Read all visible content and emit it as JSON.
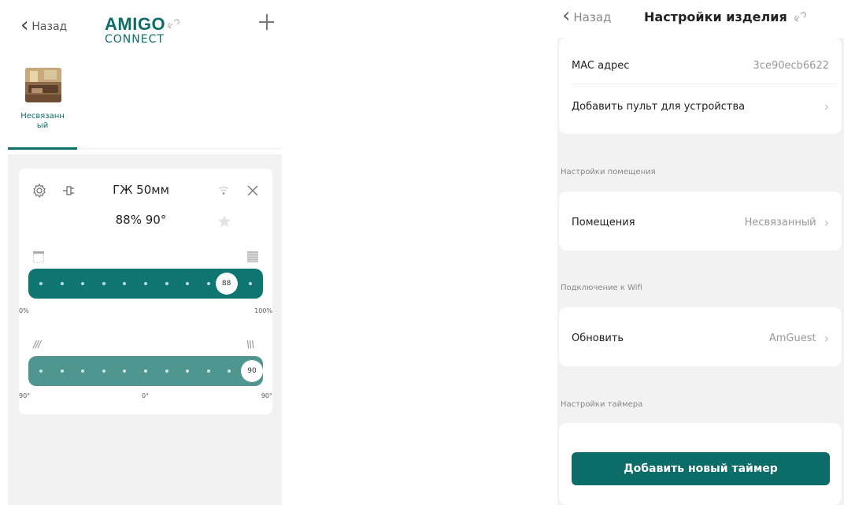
{
  "left_screen": {
    "back_label": "Назад",
    "logo": {
      "top": "AMIGO",
      "bottom": "CONNECT"
    },
    "icons": {
      "back": "chevron-left-icon",
      "add": "plus-icon"
    },
    "rooms": [
      {
        "label": "Несвязанный",
        "label_lines": [
          "Несвязанн",
          "ый"
        ],
        "selected": true
      }
    ],
    "device": {
      "name": "ГЖ 50мм",
      "status": "88% 90°",
      "icons": [
        "gear-icon",
        "plug-icon",
        "wifi-icon",
        "close-icon",
        "star-icon"
      ],
      "position_slider": {
        "value": 88,
        "knob_label": "88",
        "min_label": "0%",
        "max_label": "100%",
        "color": "#0e7571"
      },
      "tilt_slider": {
        "value": 90,
        "knob_label": "90",
        "labels": [
          "90°",
          "0°",
          "90°"
        ],
        "color": "#4f9691"
      }
    }
  },
  "right_screen": {
    "back_label": "Назад",
    "title": "Настройки изделия",
    "top_rows": [
      {
        "label": "MAC адрес",
        "value": "3ce90ecb6622",
        "arrow": false
      },
      {
        "label": "Добавить пульт для устройства",
        "value": "",
        "arrow": true
      }
    ],
    "sections": {
      "room": {
        "title": "Настройки помещения",
        "row_label": "Помещения",
        "row_value": "Несвязанный"
      },
      "wifi": {
        "title": "Подключение к Wifi",
        "row_label": "Обновить",
        "row_value": "AmGuest"
      },
      "timer": {
        "title": "Настройки таймера",
        "button_label": "Добавить новый таймер"
      }
    }
  },
  "colors": {
    "accent": "#0c6d68",
    "slider_primary": "#0e7571",
    "slider_secondary": "#4f9691",
    "background_gray": "#f2f2f2"
  }
}
